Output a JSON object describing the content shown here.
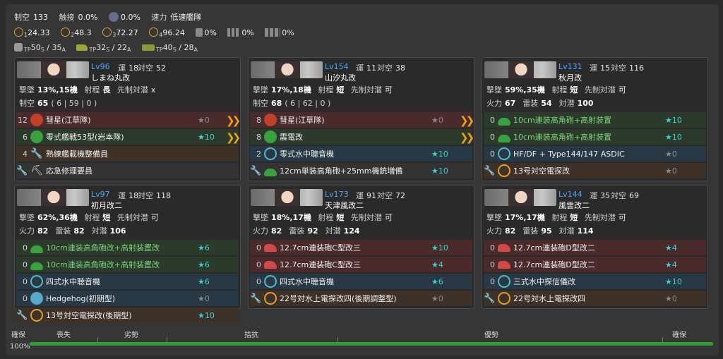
{
  "header": {
    "row1": [
      {
        "k": "制空",
        "v": "133"
      },
      {
        "k": "触接",
        "v": "0.0%"
      },
      {
        "k": "",
        "v": "0.0%"
      },
      {
        "k": "速力",
        "v": "低速艦隊"
      }
    ],
    "los": [
      "1",
      "24.33",
      "2",
      "48.3",
      "3",
      "72.27",
      "4",
      "96.24"
    ],
    "cans": [
      "0%",
      "0%",
      "0%"
    ],
    "tp": {
      "t1": "50",
      "s1": "S",
      "sep1": " / ",
      "a1": "35",
      "a1s": "A",
      "t2": "32",
      "s2": "S",
      "sep2": " / ",
      "a2": "22",
      "a2s": "A",
      "t3": "40",
      "s3": "S",
      "sep3": " / ",
      "a3": "28",
      "a3s": "A",
      "tp_label": "TP"
    }
  },
  "ships": [
    {
      "lv": "Lv96",
      "luck_k": "運",
      "luck": "18",
      "asw_k": "対空",
      "asw": "52",
      "name": "しまね丸改",
      "line3": {
        "a": "撃墜",
        "b": "13%,15機",
        "c": "射程",
        "d": "長",
        "e": "先制対潜",
        "f": "x"
      },
      "line4": {
        "a": "制空",
        "b": "65",
        "c": "( 6 | 59 | 0 )"
      },
      "slots": [
        {
          "cnt": "12",
          "icon": "bomber-icon",
          "name": "彗星(江草隊)",
          "star": "0",
          "starc": "x",
          "prof": true,
          "bg": "red"
        },
        {
          "cnt": "6",
          "icon": "fighter-icon",
          "name": "零式艦戦53型(岩本隊)",
          "star": "10",
          "starc": "g",
          "prof": true,
          "bg": "green"
        },
        {
          "cnt": "4",
          "icon": "maintenance-icon",
          "name": "熟練艦載機整備員",
          "star": "",
          "starc": "",
          "prof": false,
          "bg": "brown"
        },
        {
          "cnt": "",
          "icon": "repair-icon",
          "name": "応急修理要員",
          "star": "",
          "starc": "",
          "prof": false,
          "bg": "grey",
          "wrench": true
        }
      ]
    },
    {
      "lv": "Lv154",
      "luck_k": "運",
      "luck": "11",
      "asw_k": "対空",
      "asw": "38",
      "name": "山汐丸改",
      "line3": {
        "a": "撃墜",
        "b": "17%,18機",
        "c": "射程",
        "d": "短",
        "e": "先制対潜",
        "f": "可"
      },
      "line4": {
        "a": "制空",
        "b": "68",
        "c": "( 6 | 62 | 0 )"
      },
      "slots": [
        {
          "cnt": "8",
          "icon": "bomber-icon",
          "name": "彗星(江草隊)",
          "star": "0",
          "starc": "x",
          "prof": true,
          "bg": "red"
        },
        {
          "cnt": "8",
          "icon": "fighter-icon",
          "name": "震電改",
          "star": "",
          "starc": "",
          "prof": true,
          "bg": "green"
        },
        {
          "cnt": "2",
          "icon": "sonar-icon",
          "name": "零式水中聴音機",
          "star": "10",
          "starc": "g",
          "prof": false,
          "bg": "blue"
        },
        {
          "cnt": "",
          "icon": "aa-gun-icon",
          "name": "12cm単装高角砲+25mm機銃増備",
          "star": "10",
          "starc": "g",
          "prof": false,
          "bg": "grey",
          "wrench": true
        }
      ]
    },
    {
      "lv": "Lv131",
      "luck_k": "運",
      "luck": "15",
      "asw_k": "対空",
      "asw": "116",
      "name": "秋月改",
      "line3": {
        "a": "撃墜",
        "b": "59%,35機",
        "c": "射程",
        "d": "短",
        "e": "先制対潜",
        "f": "可"
      },
      "line4": {
        "a": "火力",
        "b": "67",
        "c2": "雷装",
        "d2": "54",
        "e2": "対潜",
        "f2": "100"
      },
      "slots": [
        {
          "cnt": "0",
          "icon": "aa-gun-icon",
          "name": "10cm連装高角砲+高射装置",
          "star": "10",
          "starc": "g",
          "prof": false,
          "bg": "green",
          "green": true
        },
        {
          "cnt": "0",
          "icon": "aa-gun-icon",
          "name": "10cm連装高角砲+高射装置",
          "star": "10",
          "starc": "g",
          "prof": false,
          "bg": "green",
          "green": true
        },
        {
          "cnt": "0",
          "icon": "sonar-icon",
          "name": "HF/DF + Type144/147 ASDIC",
          "star": "0",
          "starc": "x",
          "prof": false,
          "bg": "blue"
        },
        {
          "cnt": "",
          "icon": "radar-icon",
          "name": "13号対空電探改",
          "star": "0",
          "starc": "x",
          "prof": false,
          "bg": "brown",
          "wrench": true
        }
      ]
    },
    {
      "lv": "Lv97",
      "luck_k": "運",
      "luck": "18",
      "asw_k": "対空",
      "asw": "118",
      "name": "初月改二",
      "line3": {
        "a": "撃墜",
        "b": "62%,36機",
        "c": "射程",
        "d": "短",
        "e": "先制対潜",
        "f": "可"
      },
      "line4": {
        "a": "火力",
        "b": "82",
        "c2": "雷装",
        "d2": "82",
        "e2": "対潜",
        "f2": "106"
      },
      "slots": [
        {
          "cnt": "0",
          "icon": "aa-gun-icon",
          "name": "10cm連装高角砲改+高射装置改",
          "star": "6",
          "starc": "g",
          "prof": false,
          "bg": "green",
          "green": true
        },
        {
          "cnt": "0",
          "icon": "aa-gun-icon",
          "name": "10cm連装高角砲改+高射装置改",
          "star": "6",
          "starc": "g",
          "prof": false,
          "bg": "green",
          "green": true
        },
        {
          "cnt": "0",
          "icon": "sonar-icon",
          "name": "四式水中聴音機",
          "star": "6",
          "starc": "g",
          "prof": false,
          "bg": "blue"
        },
        {
          "cnt": "0",
          "icon": "hedgehog-icon",
          "name": "Hedgehog(初期型)",
          "star": "0",
          "starc": "x",
          "prof": false,
          "bg": "blue"
        },
        {
          "cnt": "",
          "icon": "radar-icon",
          "name": "13号対空電探改(後期型)",
          "star": "10",
          "starc": "g",
          "prof": false,
          "bg": "brown",
          "wrench": true
        }
      ]
    },
    {
      "lv": "Lv173",
      "luck_k": "運",
      "luck": "91",
      "asw_k": "対空",
      "asw": "72",
      "name": "天津風改二",
      "line3": {
        "a": "撃墜",
        "b": "18%,17機",
        "c": "射程",
        "d": "短",
        "e": "先制対潜",
        "f": "可"
      },
      "line4": {
        "a": "火力",
        "b": "82",
        "c2": "雷装",
        "d2": "92",
        "e2": "対潜",
        "f2": "124"
      },
      "slots": [
        {
          "cnt": "0",
          "icon": "main-gun-icon",
          "name": "12.7cm連装砲C型改三",
          "star": "10",
          "starc": "g",
          "prof": false,
          "bg": "red"
        },
        {
          "cnt": "0",
          "icon": "main-gun-icon",
          "name": "12.7cm連装砲C型改三",
          "star": "4",
          "starc": "g",
          "prof": false,
          "bg": "red"
        },
        {
          "cnt": "0",
          "icon": "sonar-icon",
          "name": "四式水中聴音機",
          "star": "6",
          "starc": "g",
          "prof": false,
          "bg": "blue"
        },
        {
          "cnt": "",
          "icon": "radar-icon",
          "name": "22号対水上電探改四(後期調整型)",
          "star": "0",
          "starc": "x",
          "prof": false,
          "bg": "brown",
          "wrench": true
        }
      ]
    },
    {
      "lv": "Lv144",
      "luck_k": "運",
      "luck": "35",
      "asw_k": "対空",
      "asw": "69",
      "name": "風雲改二",
      "line3": {
        "a": "撃墜",
        "b": "17%,17機",
        "c": "射程",
        "d": "短",
        "e": "先制対潜",
        "f": "可"
      },
      "line4": {
        "a": "火力",
        "b": "82",
        "c2": "雷装",
        "d2": "95",
        "e2": "対潜",
        "f2": "114"
      },
      "slots": [
        {
          "cnt": "0",
          "icon": "main-gun-icon",
          "name": "12.7cm連装砲D型改二",
          "star": "4",
          "starc": "g",
          "prof": false,
          "bg": "red"
        },
        {
          "cnt": "0",
          "icon": "main-gun-icon",
          "name": "12.7cm連装砲D型改二",
          "star": "4",
          "starc": "g",
          "prof": false,
          "bg": "red"
        },
        {
          "cnt": "0",
          "icon": "sonar-icon",
          "name": "三式水中探信儀改",
          "star": "10",
          "starc": "g",
          "prof": false,
          "bg": "blue"
        },
        {
          "cnt": "",
          "icon": "radar-icon",
          "name": "22号対水上電探改四",
          "star": "0",
          "starc": "x",
          "prof": false,
          "bg": "brown",
          "wrench": true
        }
      ]
    }
  ],
  "airbar": {
    "labels": [
      "確保",
      "喪失",
      "劣勢",
      "拮抗",
      "優勢",
      "確保"
    ],
    "percent": "100%",
    "fill": 1.0
  },
  "colors": {
    "accent": "#4aa8ff",
    "star": "#3fd0d0",
    "bar": "#2f9d3a",
    "proficiency": "#e8a020"
  }
}
